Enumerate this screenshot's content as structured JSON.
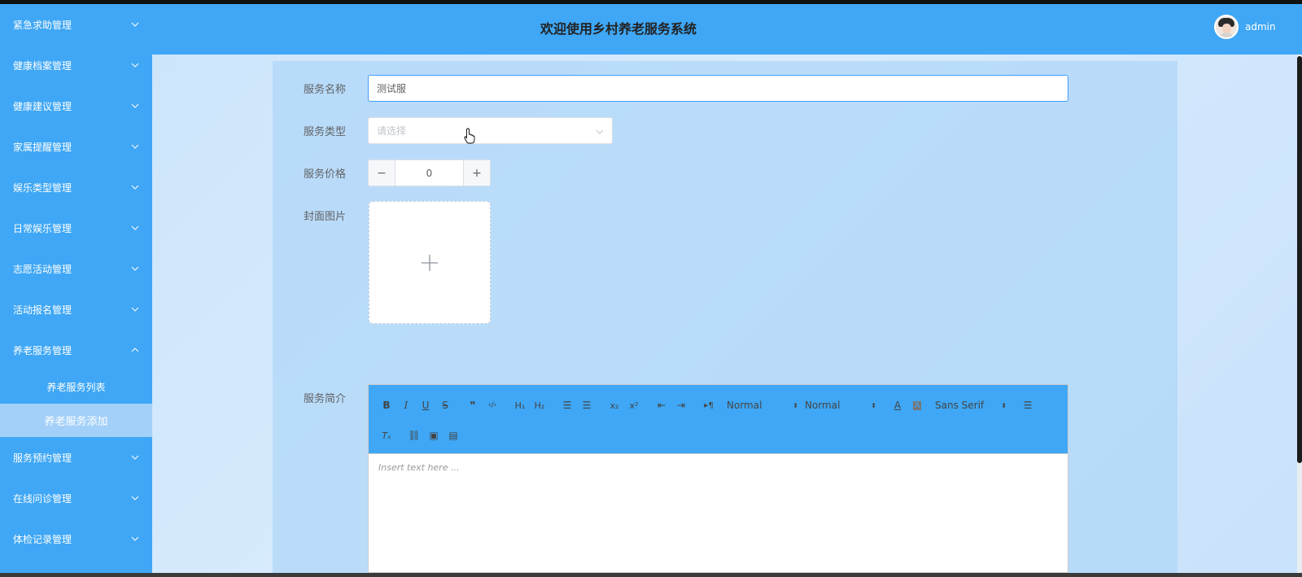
{
  "header": {
    "title": "欢迎使用乡村养老服务系统",
    "username": "admin"
  },
  "sidebar": {
    "items_top": [
      {
        "label": "紧急求助管理"
      },
      {
        "label": "健康档案管理"
      },
      {
        "label": "健康建议管理"
      },
      {
        "label": "家属提醒管理"
      },
      {
        "label": "娱乐类型管理"
      },
      {
        "label": "日常娱乐管理"
      },
      {
        "label": "志愿活动管理"
      },
      {
        "label": "活动报名管理"
      }
    ],
    "expanded": {
      "label": "养老服务管理",
      "children": [
        {
          "label": "养老服务列表"
        },
        {
          "label": "养老服务添加"
        }
      ]
    },
    "items_bottom": [
      {
        "label": "服务预约管理"
      },
      {
        "label": "在线问诊管理"
      },
      {
        "label": "体检记录管理"
      }
    ]
  },
  "form": {
    "name": {
      "label": "服务名称",
      "value": "测试服"
    },
    "type": {
      "label": "服务类型",
      "placeholder": "请选择"
    },
    "price": {
      "label": "服务价格",
      "value": "0",
      "minus": "−",
      "plus": "+"
    },
    "cover": {
      "label": "封面图片"
    },
    "intro": {
      "label": "服务简介",
      "placeholder": "Insert text here ...",
      "toolbar": {
        "header_select": "Normal",
        "size_select": "Normal",
        "font_select": "Sans Serif"
      }
    }
  },
  "colors": {
    "primary": "#3fa7f5",
    "active_submenu": "#a3d0f8",
    "input_focus": "#409eff"
  }
}
